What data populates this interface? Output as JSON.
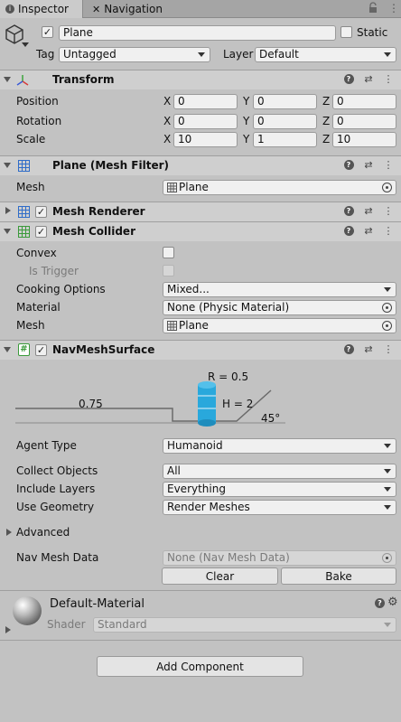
{
  "tabs": {
    "inspector": "Inspector",
    "navigation": "Navigation"
  },
  "header": {
    "name": "Plane",
    "static_label": "Static",
    "tag_label": "Tag",
    "tag_value": "Untagged",
    "layer_label": "Layer",
    "layer_value": "Default"
  },
  "transform": {
    "title": "Transform",
    "rows": [
      {
        "label": "Position",
        "x": "0",
        "y": "0",
        "z": "0"
      },
      {
        "label": "Rotation",
        "x": "0",
        "y": "0",
        "z": "0"
      },
      {
        "label": "Scale",
        "x": "10",
        "y": "1",
        "z": "10"
      }
    ],
    "axis_x": "X",
    "axis_y": "Y",
    "axis_z": "Z"
  },
  "mesh_filter": {
    "title": "Plane (Mesh Filter)",
    "mesh_label": "Mesh",
    "mesh_value": "Plane"
  },
  "mesh_renderer": {
    "title": "Mesh Renderer"
  },
  "mesh_collider": {
    "title": "Mesh Collider",
    "convex_label": "Convex",
    "is_trigger_label": "Is Trigger",
    "cooking_label": "Cooking Options",
    "cooking_value": "Mixed...",
    "material_label": "Material",
    "material_value": "None (Physic Material)",
    "mesh_label": "Mesh",
    "mesh_value": "Plane"
  },
  "navmesh": {
    "title": "NavMeshSurface",
    "diagram": {
      "radius": "R = 0.5",
      "height": "H = 2",
      "step": "0.75",
      "slope": "45°"
    },
    "agent_type_label": "Agent Type",
    "agent_type_value": "Humanoid",
    "collect_label": "Collect Objects",
    "collect_value": "All",
    "layers_label": "Include Layers",
    "layers_value": "Everything",
    "geometry_label": "Use Geometry",
    "geometry_value": "Render Meshes",
    "advanced_label": "Advanced",
    "data_label": "Nav Mesh Data",
    "data_value": "None (Nav Mesh Data)",
    "clear_label": "Clear",
    "bake_label": "Bake"
  },
  "material": {
    "name": "Default-Material",
    "shader_label": "Shader",
    "shader_value": "Standard"
  },
  "add_component_label": "Add Component",
  "icons": {
    "inspector_tab": "info-icon",
    "navigation_tab": "compass-icon",
    "lock": "lock-icon",
    "menu": "kebab-menu-icon",
    "gameobject": "cube-icon",
    "transform": "transform-axes-icon",
    "mesh_filter": "grid-icon",
    "help": "help-icon",
    "presets": "sliders-icon",
    "settings": "gear-icon"
  },
  "colors": {
    "cylinder": "#29a8dc",
    "panel": "#c2c2c2",
    "header": "#cfcfcf"
  }
}
